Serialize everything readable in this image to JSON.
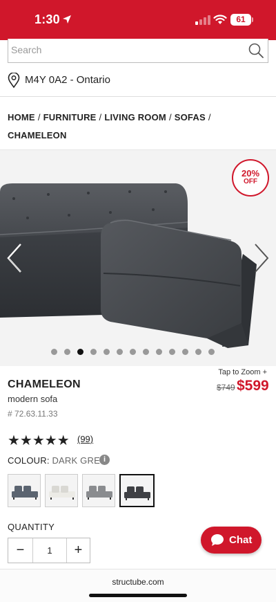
{
  "status_bar": {
    "time": "1:30",
    "battery": "61"
  },
  "search": {
    "placeholder": "Search"
  },
  "location": {
    "text": "M4Y 0A2 - Ontario"
  },
  "breadcrumb": {
    "items": [
      "HOME",
      "FURNITURE",
      "LIVING ROOM",
      "SOFAS",
      "CHAMELEON"
    ],
    "separator": "/"
  },
  "hero": {
    "discount_pct": "20%",
    "discount_label": "OFF",
    "dots_total": 13,
    "dots_active_index": 2
  },
  "product": {
    "name": "CHAMELEON",
    "subtitle": "modern sofa",
    "sku": "# 72.63.11.33",
    "tap_zoom": "Tap to Zoom +",
    "price_old": "$749",
    "price_new": "$599",
    "rating_stars": 5,
    "stars_text": "★★★★★",
    "review_count": "(99)",
    "colour_label": "COLOUR:",
    "colour_value": "DARK GREY",
    "swatch_colors": [
      "#5b6470",
      "#ecebe6",
      "#8a8c8f",
      "#3f4044"
    ],
    "swatch_selected_index": 3
  },
  "quantity": {
    "label": "QUANTITY",
    "value": "1",
    "minus": "−",
    "plus": "+"
  },
  "chat": {
    "label": "Chat"
  },
  "browser": {
    "url": "structube.com"
  },
  "colors": {
    "brand_red": "#d0172b"
  }
}
